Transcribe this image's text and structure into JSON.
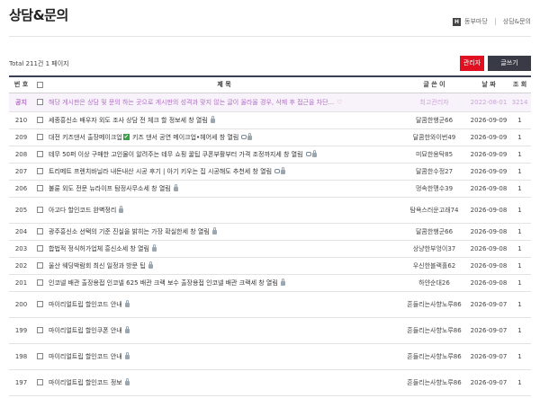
{
  "page": {
    "title": "상담&문의"
  },
  "breadcrumb": {
    "home_letter": "H",
    "items": [
      "동부마당",
      "상담&문의"
    ]
  },
  "toolbar": {
    "total": "Total 211건 1 페이지",
    "admin_label": "관리자",
    "write_label": "글쓰기"
  },
  "table": {
    "headers": {
      "num": "번 호",
      "subject": "제 목",
      "name": "글 쓴 이",
      "date": "날 짜",
      "hits": "조 회"
    },
    "notice": {
      "num": "공지",
      "subject": "해당 게시판은 상담 및 문의 하는 곳으로 게시판의 성격과 맞지 않는 글이 올라올 경우, 삭제 후 접근을 차단...",
      "name": "최고관리자",
      "date": "2022-08-01",
      "hits": "3214"
    },
    "rows": [
      {
        "num": "210",
        "subject": "세종흥신소 배우자 외도 조사 상담 전 체크 할 정보세 창 열림",
        "name": "달콤한행군66",
        "date": "2026-09-09",
        "hits": "1",
        "chat": false,
        "lock": true
      },
      {
        "num": "209",
        "subject_before": "대전 키즈댄서 출장메이크업",
        "subject_after": " 키즈 댄서 공연 메이크업•헤어세 창 열림",
        "name": "달콤한와이번49",
        "date": "2026-09-09",
        "hits": "1",
        "chat": true,
        "lock": true,
        "check": true
      },
      {
        "num": "208",
        "subject": "테무 50퍼 이상 구매한 고인물이 알려주는 테무 쇼핑 꿀팁 쿠폰부활부터 가격 조정까지세 창 열림",
        "name": "미묘한용탁85",
        "date": "2026-09-09",
        "hits": "1",
        "chat": true,
        "lock": true
      },
      {
        "num": "207",
        "subject": "트리메트 프렌치바닐라 내돈내산 시공 후기 | 아기 키우는 집 시공해도 추천세 창 열림",
        "name": "달콤한수정27",
        "date": "2026-09-09",
        "hits": "1",
        "chat": true,
        "lock": true
      },
      {
        "num": "206",
        "subject": "불륜 외도 전문 뉴라이프 탐정사무소세 창 열림",
        "name": "멍속한맹수39",
        "date": "2026-09-08",
        "hits": "1",
        "chat": false,
        "lock": true
      },
      {
        "num": "205",
        "subject": "아고다 할인코드 완벽정리",
        "name": "탐욕스러운고래74",
        "date": "2026-09-08",
        "hits": "1",
        "chat": false,
        "lock": true
      },
      {
        "num": "204",
        "subject": "광주흥신소 선택의 기준 진실을 밝히는 가장 확실한세 창 열림",
        "name": "달콤한행군66",
        "date": "2026-09-08",
        "hits": "1",
        "chat": false,
        "lock": true
      },
      {
        "num": "203",
        "subject": "합법적 정식허가업체 흥신소세 창 열림",
        "name": "상냥한부엉이37",
        "date": "2026-09-08",
        "hits": "1",
        "chat": false,
        "lock": true
      },
      {
        "num": "202",
        "subject": "울산 웨딩박람회 최신 일정과 방문 팁",
        "name": "우신한블랙홀62",
        "date": "2026-09-08",
        "hits": "1",
        "chat": false,
        "lock": true
      },
      {
        "num": "201",
        "subject": "인코넬 배관 출장용접 인코넬 625 배관 크랙 보수 출장용접 인코넬 배관 크랙세 창 열림",
        "name": "하얀순대26",
        "date": "2026-09-08",
        "hits": "1",
        "chat": false,
        "lock": true
      },
      {
        "num": "200",
        "subject": "마이리얼트립 할인코드 안내",
        "name": "흔들리는사향노루86",
        "date": "2026-09-07",
        "hits": "1",
        "chat": false,
        "lock": true
      },
      {
        "num": "199",
        "subject": "마이리얼트립 할인쿠폰 안내",
        "name": "흔들리는사향노루86",
        "date": "2026-09-07",
        "hits": "1",
        "chat": false,
        "lock": true
      },
      {
        "num": "198",
        "subject": "마이리얼트립 할인코드 안내",
        "name": "흔들리는사향노루86",
        "date": "2026-09-07",
        "hits": "1",
        "chat": false,
        "lock": true
      },
      {
        "num": "197",
        "subject": "마이리얼트립 할인코드 정보",
        "name": "흔들리는사향노루86",
        "date": "2026-09-07",
        "hits": "1",
        "chat": false,
        "lock": true
      }
    ]
  },
  "colors": {
    "admin_button": "#e01020",
    "write_button": "#383b45",
    "notice_text": "#b06cc4",
    "header_rule": "#3a3f55"
  }
}
